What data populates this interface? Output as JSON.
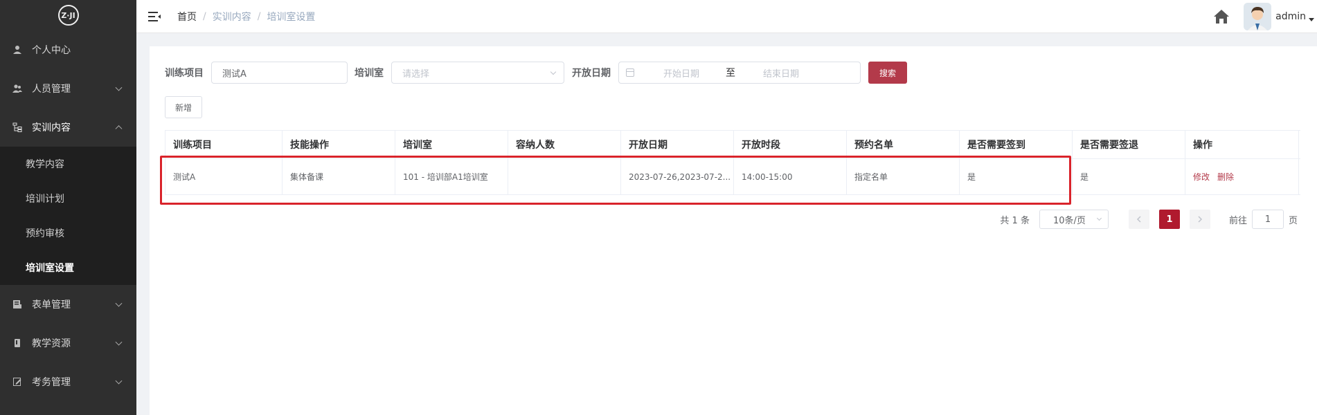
{
  "sidebar": {
    "logo_text": "Z·JI",
    "items": [
      {
        "label": "个人中心"
      },
      {
        "label": "人员管理"
      },
      {
        "label": "实训内容"
      },
      {
        "label": "表单管理"
      },
      {
        "label": "教学资源"
      },
      {
        "label": "考务管理"
      }
    ],
    "submenu": [
      {
        "label": "教学内容"
      },
      {
        "label": "培训计划"
      },
      {
        "label": "预约审核"
      },
      {
        "label": "培训室设置"
      }
    ]
  },
  "header": {
    "breadcrumb": [
      "首页",
      "实训内容",
      "培训室设置"
    ],
    "separator": "/",
    "username": "admin"
  },
  "search": {
    "project_label": "训练项目",
    "project_value": "测试A",
    "room_label": "培训室",
    "room_placeholder": "请选择",
    "date_label": "开放日期",
    "start_placeholder": "开始日期",
    "range_sep": "至",
    "end_placeholder": "结束日期",
    "search_button": "搜索"
  },
  "toolbar": {
    "add_button": "新增"
  },
  "table": {
    "columns": [
      "训练项目",
      "技能操作",
      "培训室",
      "容纳人数",
      "开放日期",
      "开放时段",
      "预约名单",
      "是否需要签到",
      "是否需要签退",
      "操作"
    ],
    "rows": [
      {
        "project": "测试A",
        "skill": "集体备课",
        "room": "101 - 培训部A1培训室",
        "capacity": "",
        "date": "2023-07-26,2023-07-2...",
        "period": "14:00-15:00",
        "list": "指定名单",
        "signin": "是",
        "signout": "是",
        "edit": "修改",
        "delete": "删除"
      }
    ]
  },
  "pagination": {
    "total": "共 1 条",
    "page_size": "10条/页",
    "current_page": "1",
    "goto_label": "前往",
    "goto_value": "1",
    "page_unit": "页"
  },
  "colors": {
    "accent": "#b33a4a",
    "sidebar_bg": "#2f2f2f",
    "highlight": "#d9232b"
  }
}
